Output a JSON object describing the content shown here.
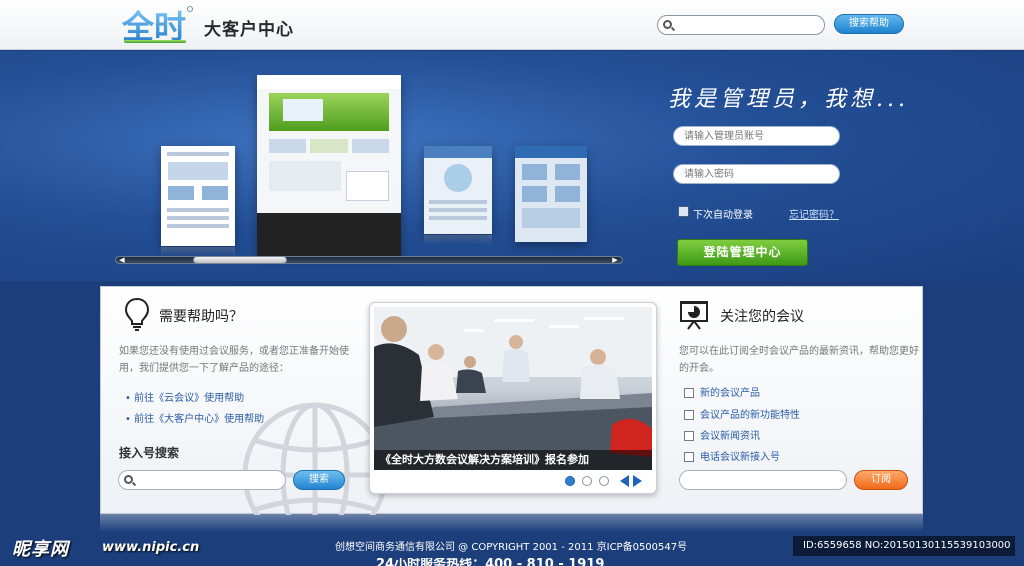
{
  "header": {
    "logo_text": "全时",
    "subtitle": "大客户中心",
    "search_placeholder": "",
    "search_button": "搜索帮助"
  },
  "hero": {
    "slogan": "我是管理员，我想...",
    "account_placeholder": "请输入管理员账号",
    "password_placeholder": "请输入密码",
    "remember_label": "下次自动登录",
    "forgot_link": "忘记密码？",
    "login_button": "登陆管理中心"
  },
  "help": {
    "title": "需要帮助吗？",
    "text": "如果您还没有使用过会议服务，或者您正准备开始使用，我们提供您一下了解产品的途径：",
    "links": [
      "前往《云会议》使用帮助",
      "前往《大客户中心》使用帮助"
    ],
    "search_title": "接入号搜索",
    "search_button": "搜索"
  },
  "slide": {
    "caption": "《全时大方数会议解决方案培训》报名参加"
  },
  "subscribe": {
    "title": "关注您的会议",
    "text": "您可以在此订阅全时会议产品的最新资讯，帮助您更好的开会。",
    "options": [
      "新的会议产品",
      "会议产品的新功能特性",
      "会议新闻资讯",
      "电话会议新接入号"
    ],
    "button": "订阅"
  },
  "footer": {
    "copyright": "创想空间商务通信有限公司  @ COPYRIGHT 2001 - 2011  京ICP备0500547号",
    "phone": "24小时服务热线：400 - 810 - 1919"
  },
  "watermark": {
    "site_name": "昵享网",
    "url": "www.nipic.cn",
    "id": "ID:6559658 NO:20150130115539103000"
  },
  "colors": {
    "brand_green": "#3e9a16",
    "brand_blue": "#1c3f7c",
    "accent_orange": "#f06a1b"
  }
}
